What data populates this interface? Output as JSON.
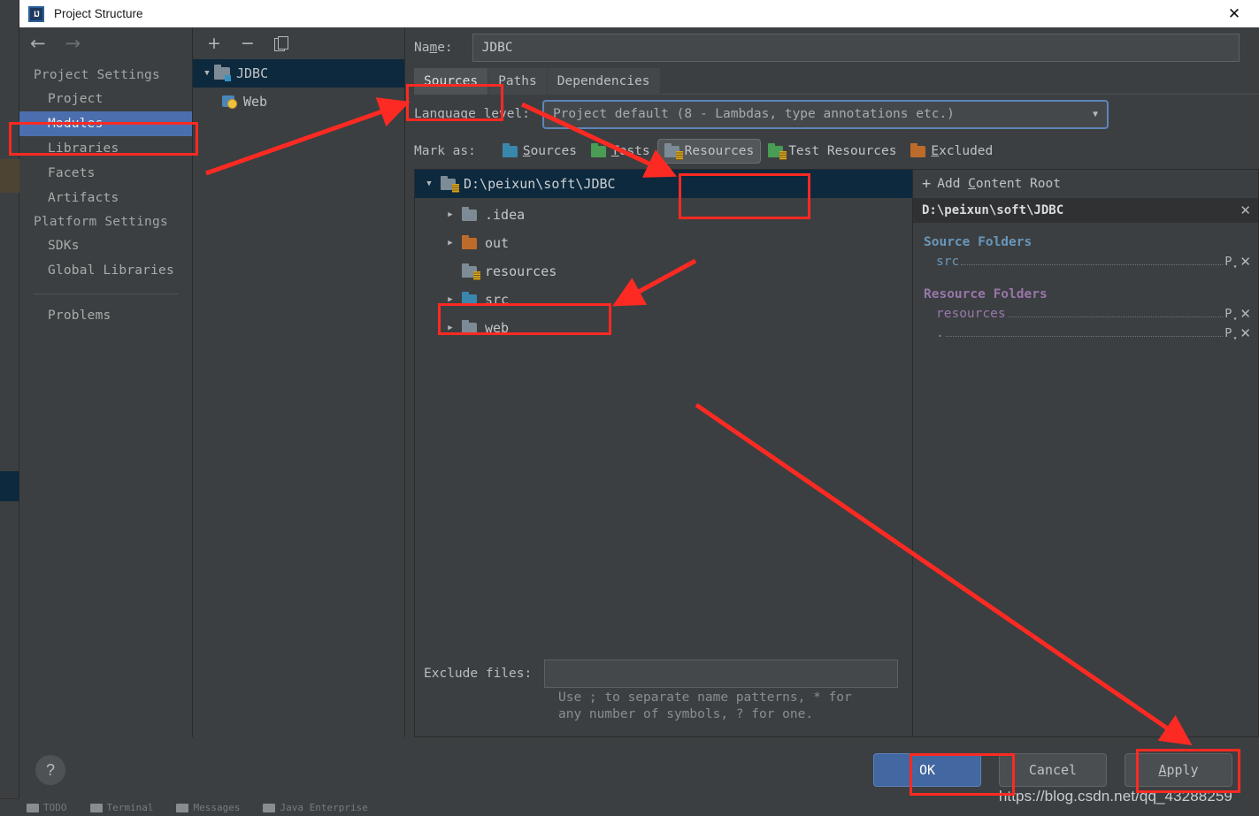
{
  "window": {
    "title": "Project Structure",
    "icon": "intellij-idea-icon",
    "close_label": "✕"
  },
  "sidebar": {
    "back_icon": "arrow-left-icon",
    "forward_icon": "arrow-right-icon",
    "groups": [
      {
        "label": "Project Settings",
        "items": [
          {
            "label": "Project",
            "selected": false
          },
          {
            "label": "Modules",
            "selected": true
          },
          {
            "label": "Libraries",
            "selected": false
          },
          {
            "label": "Facets",
            "selected": false
          },
          {
            "label": "Artifacts",
            "selected": false
          }
        ]
      },
      {
        "label": "Platform Settings",
        "items": [
          {
            "label": "SDKs",
            "selected": false
          },
          {
            "label": "Global Libraries",
            "selected": false
          }
        ]
      }
    ],
    "problems": {
      "label": "Problems"
    }
  },
  "modules_panel": {
    "toolbar": {
      "add": "+",
      "remove": "−",
      "copy_icon": "copy-icon"
    },
    "tree": [
      {
        "label": "JDBC",
        "icon": "module-folder-icon",
        "expanded": true,
        "selected": true,
        "arrow": "▼"
      },
      {
        "label": "Web",
        "icon": "web-facet-icon",
        "selected": false
      }
    ]
  },
  "main": {
    "name_label": "Name:",
    "name_label_mnemonic": "m",
    "name_value": "JDBC",
    "tabs": [
      {
        "label": "Sources",
        "active": true
      },
      {
        "label": "Paths",
        "active": false
      },
      {
        "label": "Dependencies",
        "active": false
      }
    ],
    "language_level": {
      "label": "Language level:",
      "value": "Project default (8 - Lambdas, type annotations etc.)",
      "arrow_icon": "chevron-down-icon"
    },
    "mark_as": {
      "label": "Mark as:",
      "options": [
        {
          "label": "Sources",
          "color": "blue",
          "pressed": false
        },
        {
          "label": "Tests",
          "color": "green",
          "pressed": false
        },
        {
          "label": "Resources",
          "color": "gray",
          "pressed": true
        },
        {
          "label": "Test Resources",
          "color": "greenres",
          "pressed": false
        },
        {
          "label": "Excluded",
          "color": "orange",
          "pressed": false
        }
      ]
    },
    "content_tree": {
      "root": {
        "label": "D:\\peixun\\soft\\JDBC",
        "icon": "resources-folder-icon",
        "arrow": "▼"
      },
      "children": [
        {
          "label": ".idea",
          "color": "gray",
          "arrow": "▶",
          "has_arrow": true,
          "is_resource": false
        },
        {
          "label": "out",
          "color": "orange",
          "arrow": "▶",
          "has_arrow": true,
          "is_resource": false
        },
        {
          "label": "resources",
          "color": "gray",
          "arrow": "",
          "has_arrow": false,
          "is_resource": true
        },
        {
          "label": "src",
          "color": "blue",
          "arrow": "▶",
          "has_arrow": true,
          "is_resource": false
        },
        {
          "label": "web",
          "color": "gray",
          "arrow": "▶",
          "has_arrow": true,
          "is_resource": false
        }
      ]
    },
    "exclude": {
      "label": "Exclude files:",
      "value": "",
      "placeholder": "",
      "hint_line1": "Use ; to separate name patterns, * for",
      "hint_line2": "any number of symbols, ? for one."
    }
  },
  "right_pane": {
    "add_content_root": {
      "label": "Add Content Root",
      "mnemonic": "C",
      "icon": "plus-icon"
    },
    "root_path": "D:\\peixun\\soft\\JDBC",
    "root_remove_icon": "close-icon",
    "sections": [
      {
        "title": "Source Folders",
        "kind": "src",
        "entries": [
          {
            "name": "src",
            "package_prefix_icon": "package-prefix-icon",
            "remove_icon": "close-icon"
          }
        ]
      },
      {
        "title": "Resource Folders",
        "kind": "res",
        "entries": [
          {
            "name": "resources",
            "package_prefix_icon": "package-prefix-icon",
            "remove_icon": "close-icon"
          },
          {
            "name": ".",
            "package_prefix_icon": "package-prefix-icon",
            "remove_icon": "close-icon"
          }
        ]
      }
    ]
  },
  "footer": {
    "help_label": "?",
    "ok_label": "OK",
    "cancel_label": "Cancel",
    "apply_label": "Apply",
    "apply_mnemonic": "A",
    "watermark": "https://blog.csdn.net/qq_43288259"
  },
  "ide_background": {
    "bottom_tools": [
      "TODO",
      "Terminal",
      "Messages",
      "Java Enterprise"
    ]
  },
  "colors": {
    "accent_selection": "#4b6eaf",
    "tree_selection": "#0d293e",
    "annotation_red": "#fc2a22",
    "primary_button": "#4267a1",
    "source_folder_text": "#6897bb",
    "resource_folder_text": "#9876aa",
    "dialog_bg": "#3c3f41"
  }
}
